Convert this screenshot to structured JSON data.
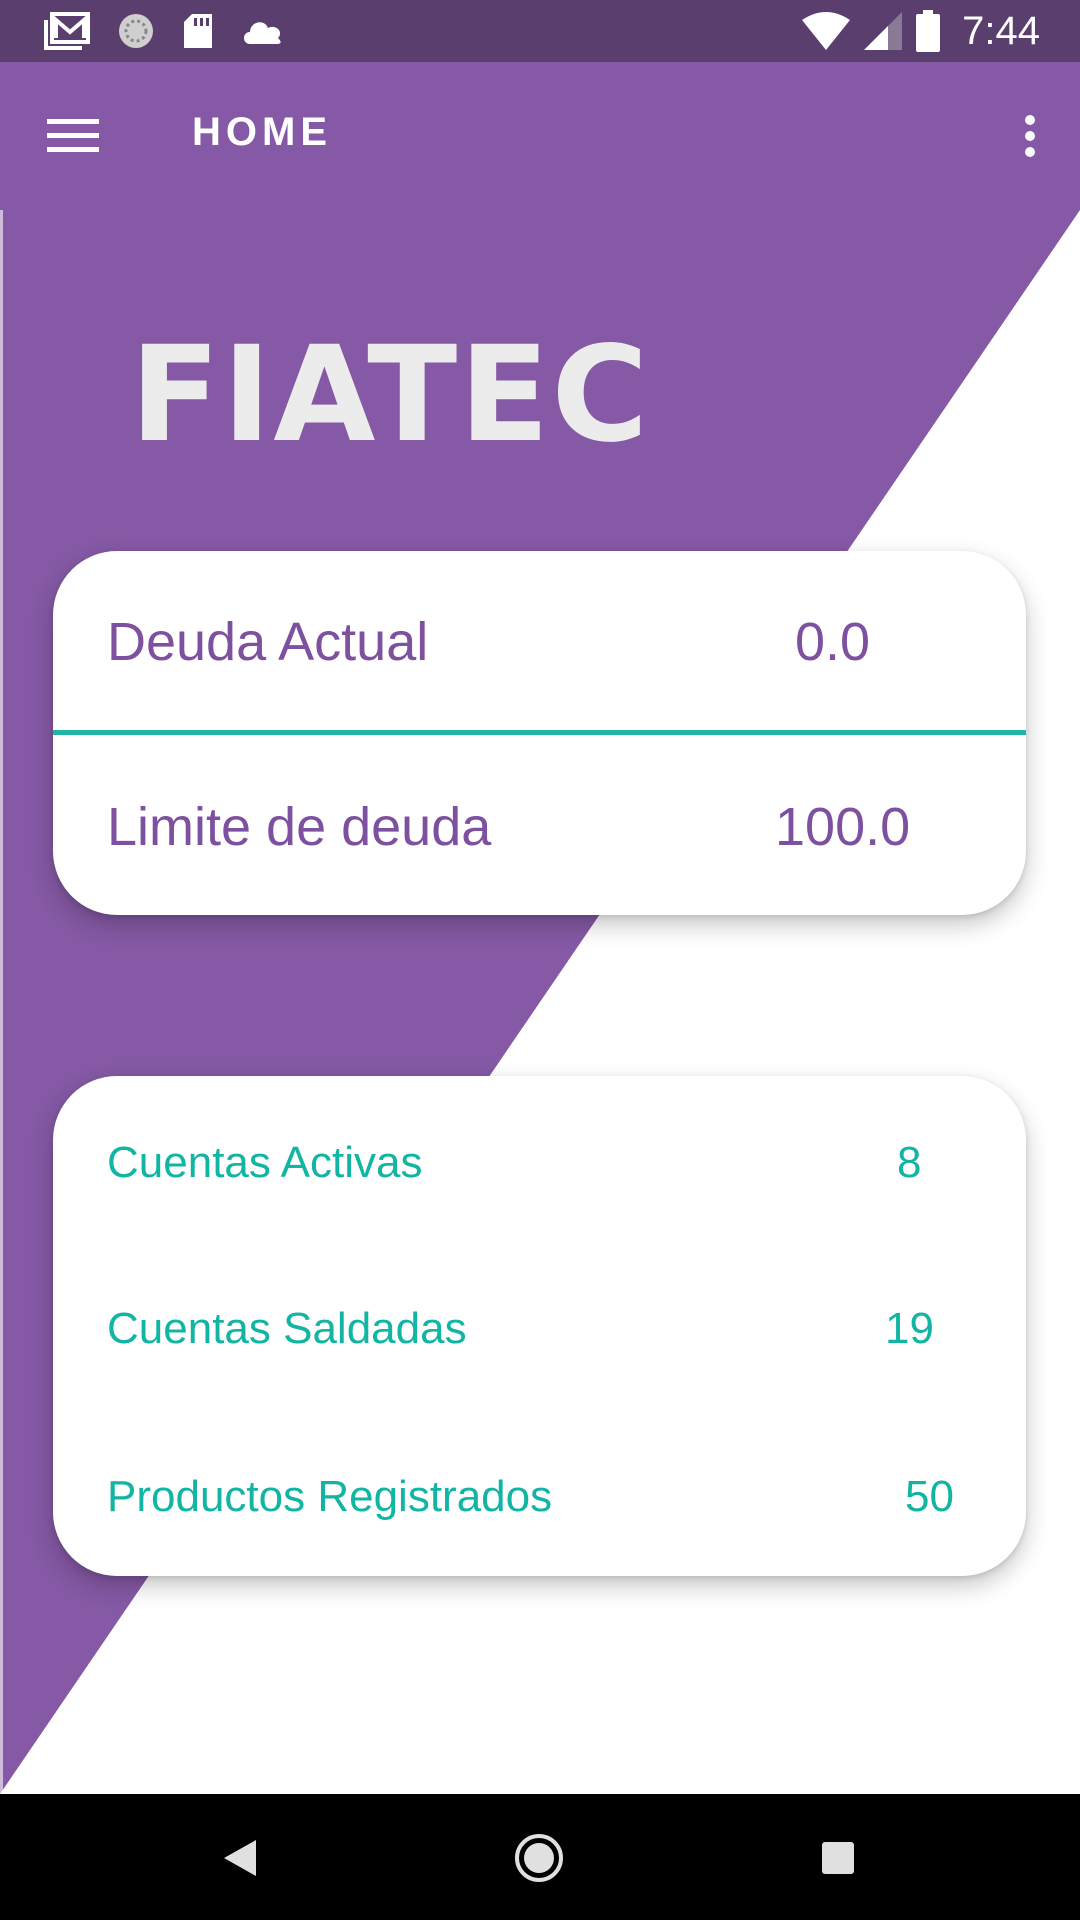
{
  "status_bar": {
    "time": "7:44",
    "left_icons": [
      "gmail-icon",
      "sync-icon",
      "sd-card-icon",
      "cloud-icon"
    ],
    "right_icons": [
      "wifi-icon",
      "signal-icon",
      "battery-icon"
    ]
  },
  "app_bar": {
    "title": "HOME",
    "menu_icon": "hamburger-menu-icon",
    "overflow_icon": "more-vert-icon"
  },
  "logo": {
    "text": "FIATEC"
  },
  "debt_card": {
    "current_debt_label": "Deuda Actual",
    "current_debt_value": "0.0",
    "debt_limit_label": "Limite de deuda",
    "debt_limit_value": "100.0"
  },
  "stats_card": {
    "items": [
      {
        "label": "Cuentas Activas",
        "value": "8"
      },
      {
        "label": "Cuentas Saldadas",
        "value": "19"
      },
      {
        "label": "Productos Registrados",
        "value": "50"
      }
    ]
  },
  "nav_bar": {
    "icons": [
      "back-icon",
      "home-icon",
      "recents-icon"
    ]
  },
  "colors": {
    "primary": "#8559a5",
    "primary_dark": "#5a3e6e",
    "accent": "#12b5a4",
    "debt_text": "#7e50a0",
    "logo_text": "#ececec"
  }
}
